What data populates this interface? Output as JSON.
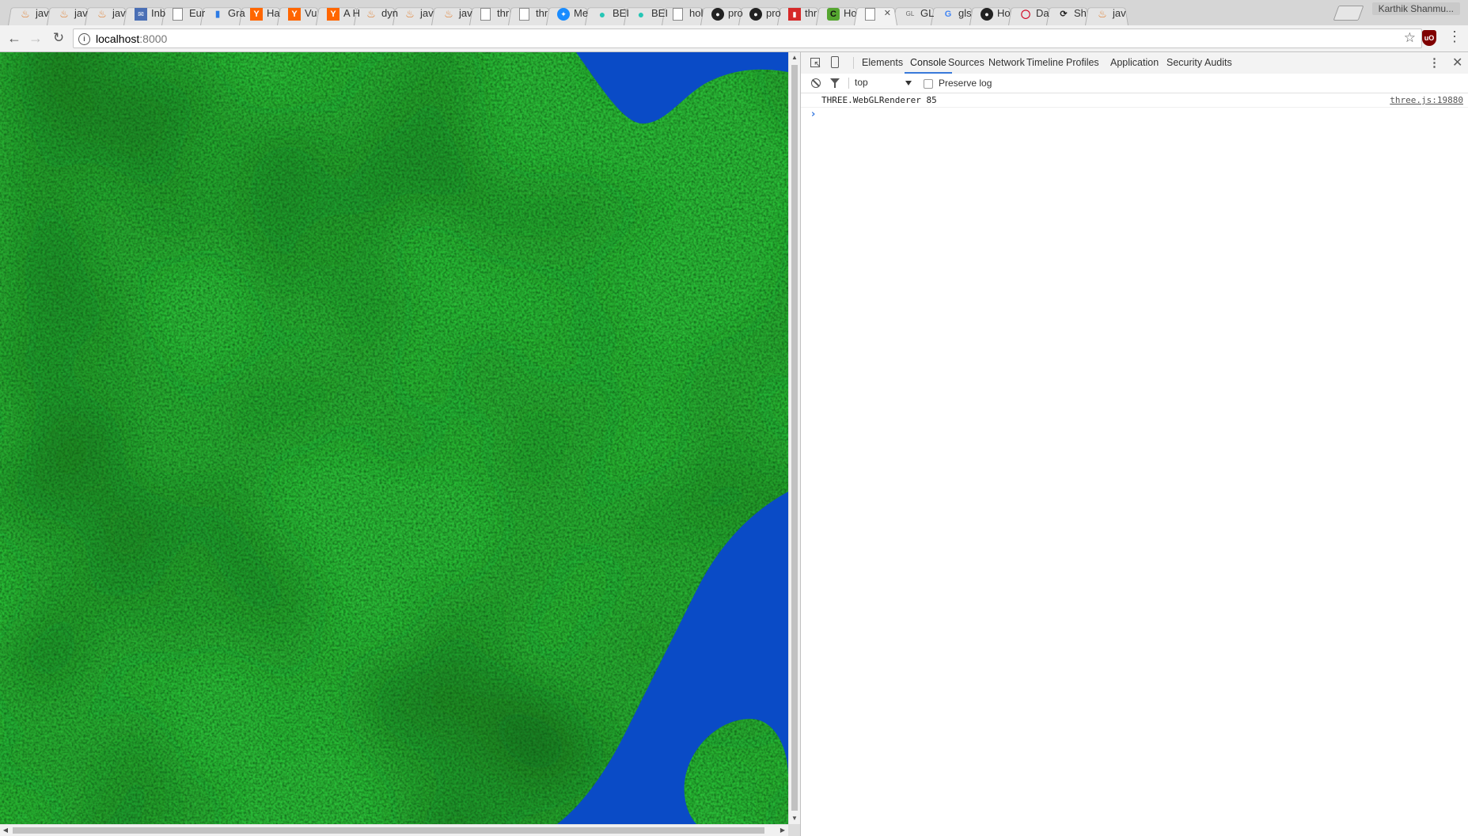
{
  "tabs": [
    {
      "title": "jav",
      "icon": "java-icon"
    },
    {
      "title": "jav",
      "icon": "java-icon"
    },
    {
      "title": "jav",
      "icon": "java-icon"
    },
    {
      "title": "Inb",
      "icon": "mail-icon"
    },
    {
      "title": "Eur",
      "icon": "document-icon"
    },
    {
      "title": "Gra",
      "icon": "chart-icon"
    },
    {
      "title": "Ha",
      "icon": "ycombinator-icon"
    },
    {
      "title": "Vu",
      "icon": "ycombinator-icon"
    },
    {
      "title": "A H",
      "icon": "ycombinator-icon"
    },
    {
      "title": "dyn",
      "icon": "java-icon"
    },
    {
      "title": "jav",
      "icon": "java-icon"
    },
    {
      "title": "jav",
      "icon": "java-icon"
    },
    {
      "title": "thr",
      "icon": "document-icon"
    },
    {
      "title": "thr",
      "icon": "document-icon"
    },
    {
      "title": "Me",
      "icon": "messenger-icon"
    },
    {
      "title": "BEI",
      "icon": "dot-icon"
    },
    {
      "title": "BEI",
      "icon": "dot-icon"
    },
    {
      "title": "hol",
      "icon": "document-icon"
    },
    {
      "title": "pro",
      "icon": "github-icon"
    },
    {
      "title": "pro",
      "icon": "github-icon"
    },
    {
      "title": "thr",
      "icon": "red-square-icon"
    },
    {
      "title": "Ho",
      "icon": "codeguru-icon"
    },
    {
      "title": "",
      "icon": "document-icon",
      "active": true
    },
    {
      "title": "GL",
      "icon": "gl-icon"
    },
    {
      "title": "gls",
      "icon": "google-icon"
    },
    {
      "title": "Ho",
      "icon": "github-icon"
    },
    {
      "title": "Da",
      "icon": "oracle-icon"
    },
    {
      "title": "Sh",
      "icon": "shift-icon"
    },
    {
      "title": "jav",
      "icon": "java-icon"
    }
  ],
  "profile_name": "Karthik Shanmu...",
  "address": {
    "host": "localhost",
    "port": ":8000"
  },
  "devtools": {
    "tabs": [
      "Elements",
      "Console",
      "Sources",
      "Network",
      "Timeline",
      "Profiles",
      "Application",
      "Security",
      "Audits"
    ],
    "active_tab": "Console",
    "context": "top",
    "preserve_log_label": "Preserve log",
    "messages": [
      {
        "text": "THREE.WebGLRenderer 85",
        "source": "three.js:19880"
      }
    ]
  },
  "colors": {
    "grass": "#2a9a2a",
    "water": "#0a4bc6",
    "accent": "#3879d9"
  }
}
